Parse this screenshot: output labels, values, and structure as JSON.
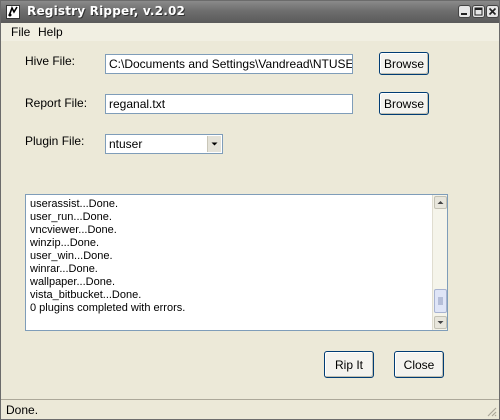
{
  "window": {
    "title": "Registry Ripper, v.2.02"
  },
  "menu": {
    "file": "File",
    "help": "Help"
  },
  "form": {
    "hive_label": "Hive File:",
    "hive_value": "C:\\Documents and Settings\\Vandread\\NTUSER.",
    "report_label": "Report File:",
    "report_value": "reganal.txt",
    "plugin_label": "Plugin File:",
    "plugin_value": "ntuser",
    "browse_label": "Browse"
  },
  "log": {
    "lines": [
      "userassist...Done.",
      "user_run...Done.",
      "vncviewer...Done.",
      "winzip...Done.",
      "user_win...Done.",
      "winrar...Done.",
      "wallpaper...Done.",
      "vista_bitbucket...Done.",
      "0 plugins completed with errors."
    ]
  },
  "actions": {
    "rip_label": "Rip It",
    "close_label": "Close"
  },
  "status": {
    "text": "Done."
  },
  "icons": {
    "app": "registry-ripper-icon",
    "minimize": "minimize-icon",
    "maximize": "maximize-icon",
    "close": "close-icon",
    "dropdown": "chevron-down-icon",
    "scroll_up": "arrow-up-icon",
    "scroll_down": "arrow-down-icon"
  },
  "colors": {
    "titlebar": "#6e6e6e",
    "window_bg": "#ece9d8",
    "field_border": "#7f9db9"
  }
}
